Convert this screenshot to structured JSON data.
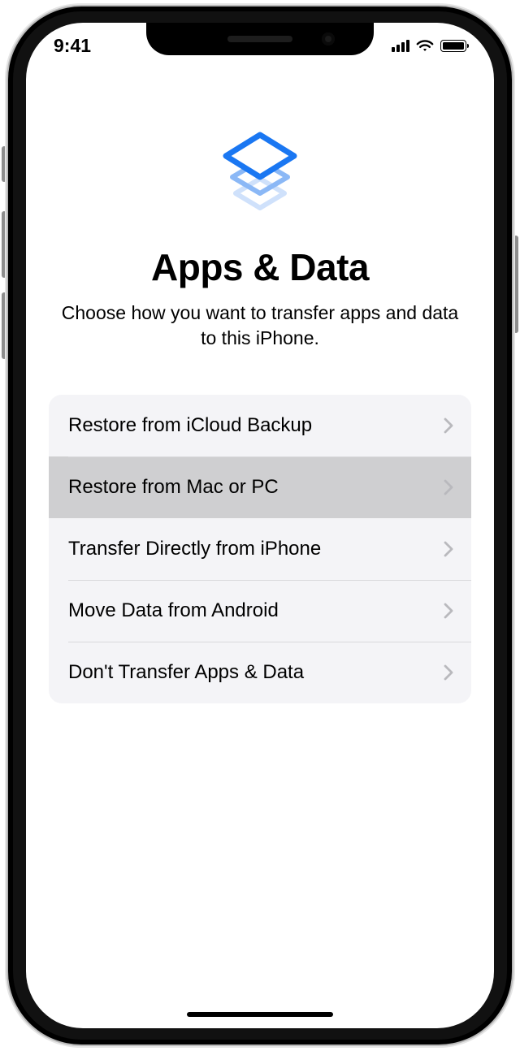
{
  "status": {
    "time": "9:41"
  },
  "page": {
    "title": "Apps & Data",
    "subtitle": "Choose how you want to transfer apps and data to this iPhone."
  },
  "options": [
    {
      "label": "Restore from iCloud Backup",
      "selected": false
    },
    {
      "label": "Restore from Mac or PC",
      "selected": true
    },
    {
      "label": "Transfer Directly from iPhone",
      "selected": false
    },
    {
      "label": "Move Data from Android",
      "selected": false
    },
    {
      "label": "Don't Transfer Apps & Data",
      "selected": false
    }
  ]
}
